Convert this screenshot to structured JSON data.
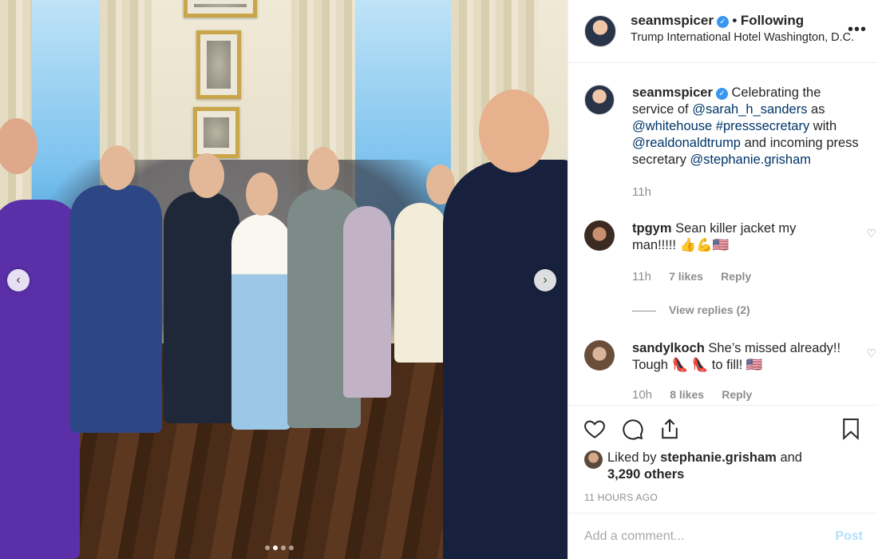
{
  "post": {
    "username": "seanmspicer",
    "separator": "•",
    "follow_status": "Following",
    "location": "Trump International Hotel Washington, D.C.",
    "more_label": "•••",
    "caption_parts": [
      {
        "type": "text",
        "value": "Celebrating the service of "
      },
      {
        "type": "link",
        "value": "@sarah_h_sanders"
      },
      {
        "type": "text",
        "value": " as "
      },
      {
        "type": "link",
        "value": "@whitehouse"
      },
      {
        "type": "text",
        "value": " "
      },
      {
        "type": "link",
        "value": "#presssecretary"
      },
      {
        "type": "text",
        "value": " with "
      },
      {
        "type": "link",
        "value": "@realdonaldtrump"
      },
      {
        "type": "text",
        "value": " and incoming press secretary "
      },
      {
        "type": "link",
        "value": "@stephanie.grisham"
      }
    ],
    "caption_time": "11h"
  },
  "comments": [
    {
      "username": "tpgym",
      "text": "Sean killer jacket my man!!!!! 👍💪🇺🇸",
      "time": "11h",
      "likes": "7 likes",
      "reply": "Reply",
      "view_replies": "View replies (2)"
    },
    {
      "username": "sandylkoch",
      "text": "She’s missed already!! Tough 👠 👠 to fill! 🇺🇸",
      "time": "10h",
      "likes": "8 likes",
      "reply": "Reply"
    }
  ],
  "likes": {
    "prefix": "Liked by",
    "user": "stephanie.grisham",
    "middle": "and",
    "others": "3,290 others"
  },
  "timestamp": "11 HOURS AGO",
  "add_comment": {
    "placeholder": "Add a comment...",
    "post_label": "Post"
  },
  "carousel": {
    "prev": "‹",
    "next": "›",
    "count": 4,
    "active_index": 1
  },
  "colors": {
    "link": "#003569",
    "verified": "#3897f0",
    "muted": "#8e8e8e",
    "post_disabled": "#b2dffc"
  }
}
